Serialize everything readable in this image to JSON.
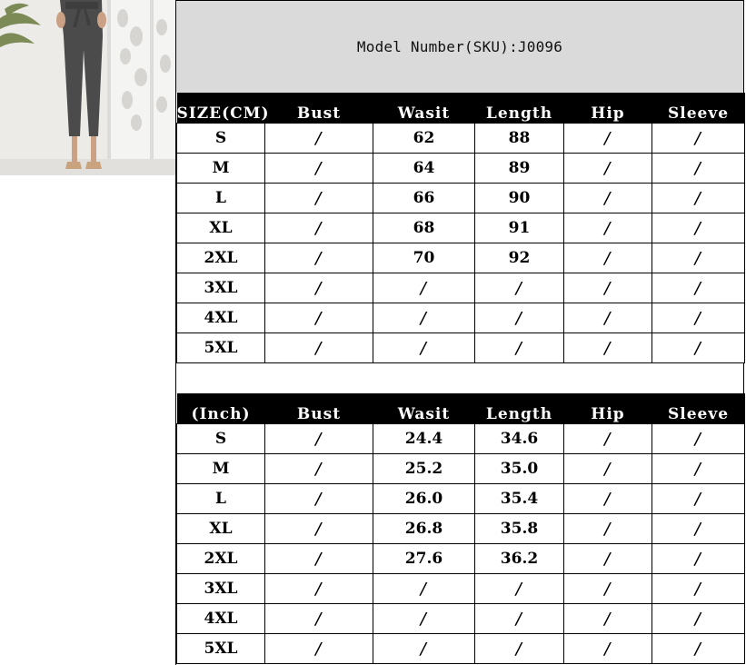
{
  "model_number": "Model Number(SKU):J0096",
  "table_cm": {
    "headers": [
      "SIZE(CM)",
      "Bust",
      "Wasit",
      "Length",
      "Hip",
      "Sleeve"
    ],
    "rows": [
      [
        "S",
        "/",
        "62",
        "88",
        "/",
        "/"
      ],
      [
        "M",
        "/",
        "64",
        "89",
        "/",
        "/"
      ],
      [
        "L",
        "/",
        "66",
        "90",
        "/",
        "/"
      ],
      [
        "XL",
        "/",
        "68",
        "91",
        "/",
        "/"
      ],
      [
        "2XL",
        "/",
        "70",
        "92",
        "/",
        "/"
      ],
      [
        "3XL",
        "/",
        "/",
        "/",
        "/",
        "/"
      ],
      [
        "4XL",
        "/",
        "/",
        "/",
        "/",
        "/"
      ],
      [
        "5XL",
        "/",
        "/",
        "/",
        "/",
        "/"
      ]
    ]
  },
  "table_inch": {
    "headers": [
      "(Inch)",
      "Bust",
      "Wasit",
      "Length",
      "Hip",
      "Sleeve"
    ],
    "rows": [
      [
        "S",
        "/",
        "24.4",
        "34.6",
        "/",
        "/"
      ],
      [
        "M",
        "/",
        "25.2",
        "35.0",
        "/",
        "/"
      ],
      [
        "L",
        "/",
        "26.0",
        "35.4",
        "/",
        "/"
      ],
      [
        "XL",
        "/",
        "26.8",
        "35.8",
        "/",
        "/"
      ],
      [
        "2XL",
        "/",
        "27.6",
        "36.2",
        "/",
        "/"
      ],
      [
        "3XL",
        "/",
        "/",
        "/",
        "/",
        "/"
      ],
      [
        "4XL",
        "/",
        "/",
        "/",
        "/",
        "/"
      ],
      [
        "5XL",
        "/",
        "/",
        "/",
        "/",
        "/"
      ]
    ]
  }
}
